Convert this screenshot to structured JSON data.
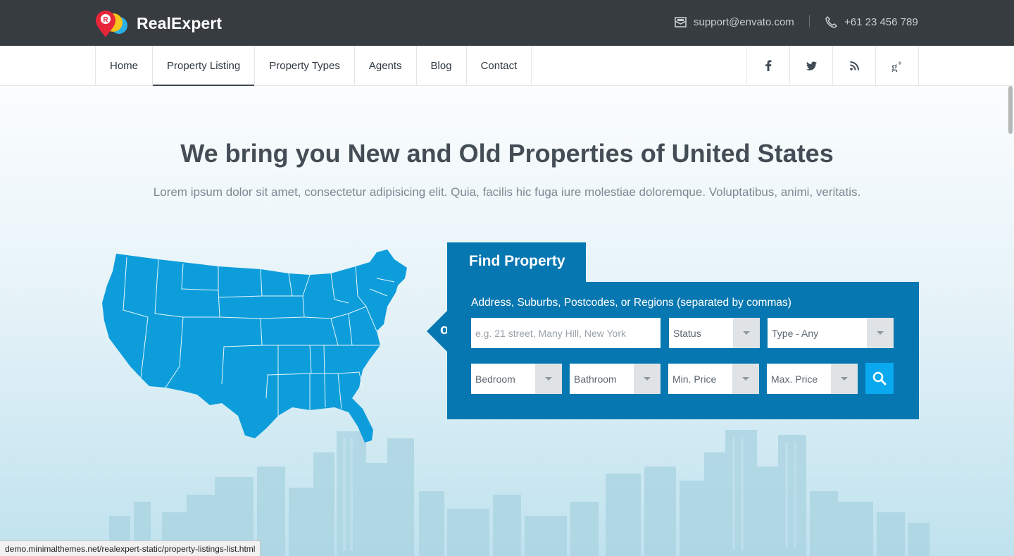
{
  "brand": {
    "name": "RealExpert",
    "logo_letter": "R",
    "logo_colors": [
      "#e8263a",
      "#f7c21b",
      "#2ab0e6"
    ]
  },
  "header": {
    "email": "support@envato.com",
    "email_icon": "mail-icon",
    "phone": "+61 23 456 789",
    "phone_icon": "phone-icon"
  },
  "nav": {
    "items": [
      {
        "label": "Home"
      },
      {
        "label": "Property Listing"
      },
      {
        "label": "Property Types"
      },
      {
        "label": "Agents"
      },
      {
        "label": "Blog"
      },
      {
        "label": "Contact"
      }
    ],
    "active_index": 1,
    "social": [
      {
        "name": "facebook-icon",
        "glyph": "f"
      },
      {
        "name": "twitter-icon",
        "glyph": "t"
      },
      {
        "name": "rss-icon",
        "glyph": "rss"
      },
      {
        "name": "google-plus-icon",
        "glyph": "g+"
      }
    ]
  },
  "hero": {
    "title": "We bring you New and Old Properties of United States",
    "subtitle": "Lorem ipsum dolor sit amet, consectetur adipisicing elit. Quia, facilis hic fuga iure molestiae doloremque. Voluptatibus, animi, veritatis."
  },
  "search": {
    "tab_label": "Find Property",
    "or_label": "or",
    "field_label": "Address, Suburbs, Postcodes, or Regions (separated by commas)",
    "address_placeholder": "e.g. 21 street, Many Hill, New York",
    "status": "Status",
    "type": "Type - Any",
    "bedroom": "Bedroom",
    "bathroom": "Bathroom",
    "min_price": "Min. Price",
    "max_price": "Max. Price",
    "search_icon": "search-icon"
  },
  "colors": {
    "topbar": "#373c41",
    "panel": "#0777b1",
    "accent": "#08a9ee",
    "map": "#0d9ddb"
  },
  "statusbar": {
    "url": "demo.minimalthemes.net/realexpert-static/property-listings-list.html"
  }
}
